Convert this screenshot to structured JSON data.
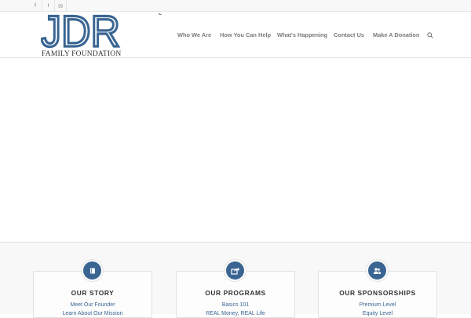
{
  "topbar": {
    "social": [
      {
        "icon": "facebook-icon",
        "glyph": "f"
      },
      {
        "icon": "twitter-icon",
        "glyph": "t"
      },
      {
        "icon": "mail-icon",
        "glyph": "✉"
      }
    ]
  },
  "logo": {
    "letters": "JDR",
    "tm": "™",
    "subtitle": "FAMILY FOUNDATION",
    "color": "#3a6593"
  },
  "nav": {
    "items": [
      "Who We Are",
      "How You Can Help",
      "What's Happening",
      "Contact Us",
      "Make A Donation"
    ],
    "search_icon": "search-icon"
  },
  "cards": [
    {
      "icon": "book-icon",
      "title": "OUR STORY",
      "links": [
        "Meet Our Founder",
        "Learn About Our Mission"
      ]
    },
    {
      "icon": "share-icon",
      "title": "OUR PROGRAMS",
      "links": [
        "Basics 101",
        "REAL Money, REAL Life"
      ]
    },
    {
      "icon": "users-icon",
      "title": "OUR SPONSORSHIPS",
      "links": [
        "Premium Level",
        "Equity Level"
      ]
    }
  ],
  "colors": {
    "accent": "#3a6593",
    "nav_text": "#7b7b7b",
    "muted_bg": "#f8f8f8"
  }
}
